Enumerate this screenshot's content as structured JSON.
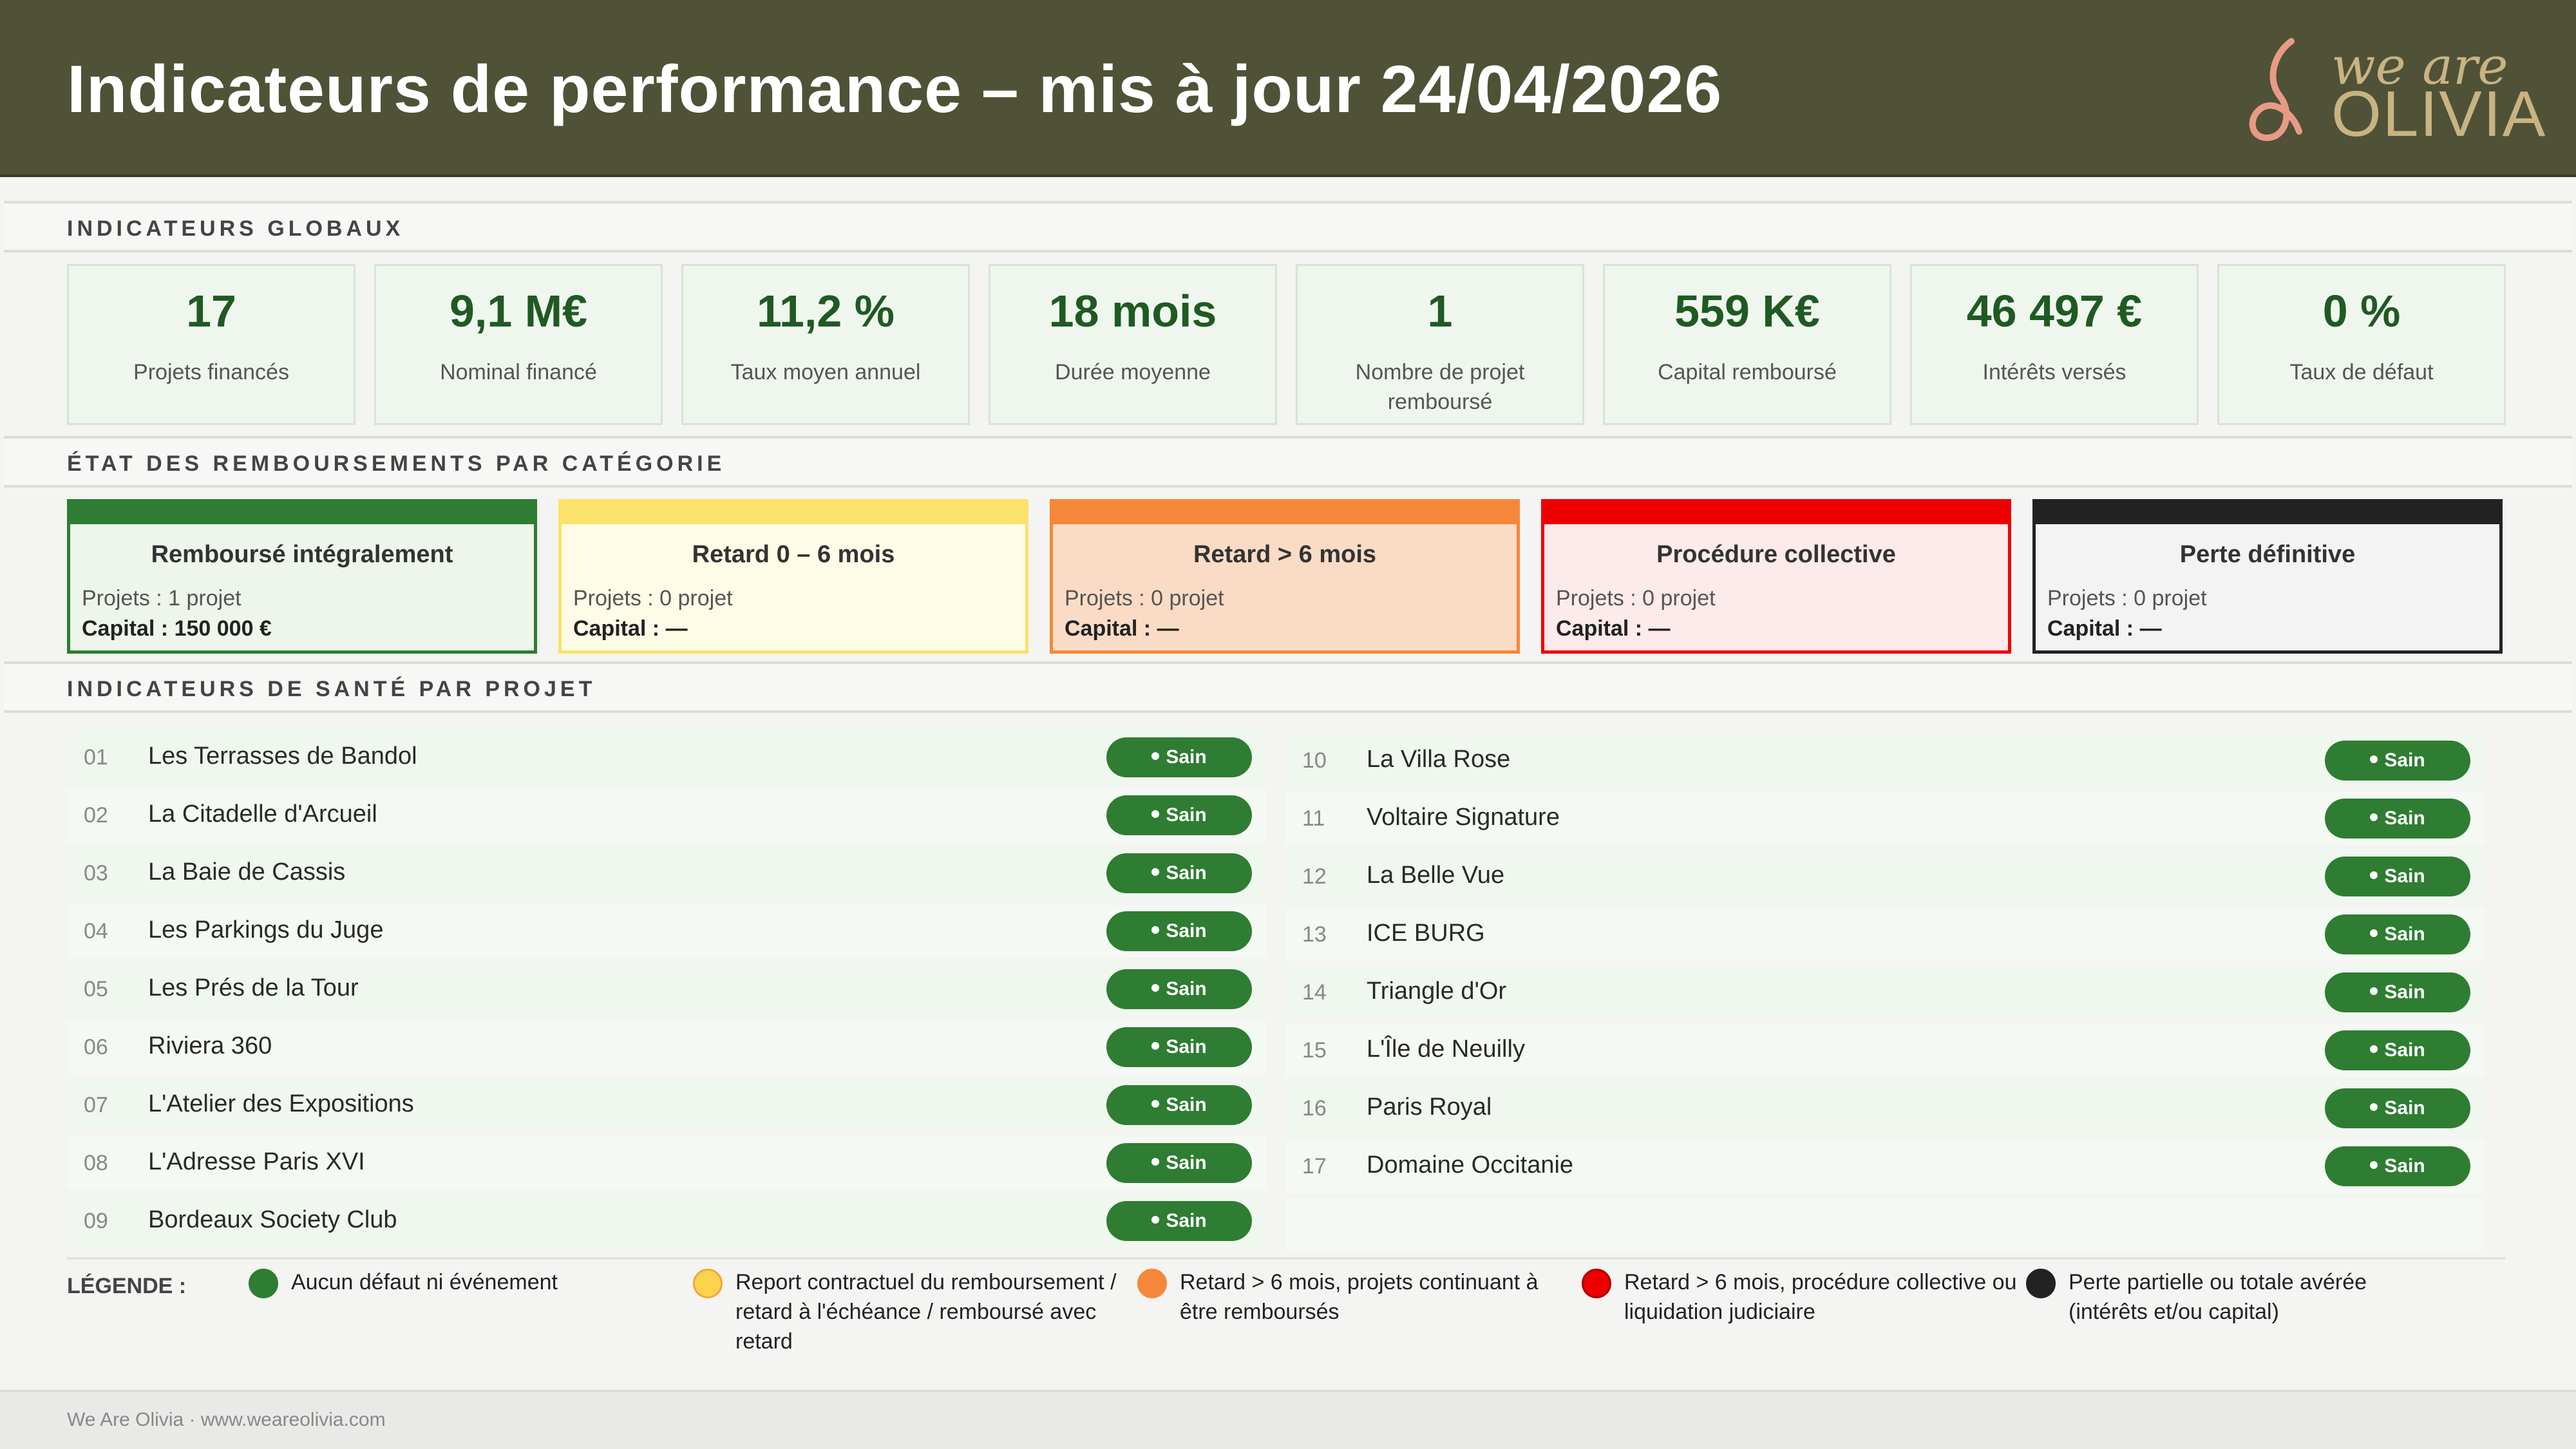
{
  "header": {
    "title": "Indicateurs de performance – mis à jour 24/04/2026",
    "logo_line1": "we are",
    "logo_line2": "OLIVIA"
  },
  "sections": {
    "global": "INDICATEURS GLOBAUX",
    "categories": "ÉTAT DES REMBOURSEMENTS PAR CATÉGORIE",
    "health": "INDICATEURS DE SANTÉ PAR PROJET"
  },
  "kpis": [
    {
      "value": "17",
      "label": "Projets financés"
    },
    {
      "value": "9,1 M€",
      "label": "Nominal financé"
    },
    {
      "value": "11,2 %",
      "label": "Taux moyen annuel"
    },
    {
      "value": "18 mois",
      "label": "Durée moyenne"
    },
    {
      "value": "1",
      "label": "Nombre de projet remboursé"
    },
    {
      "value": "559 K€",
      "label": "Capital remboursé"
    },
    {
      "value": "46 497 €",
      "label": "Intérêts versés"
    },
    {
      "value": "0 %",
      "label": "Taux de défaut"
    }
  ],
  "categories": [
    {
      "title": "Remboursé  intégralement",
      "projects": "Projets : 1 projet",
      "capital": "Capital : 150 000 €",
      "color": "#2e7d32",
      "bg": "#eef6ec"
    },
    {
      "title": "Retard  0 – 6 mois",
      "projects": "Projets : 0 projet",
      "capital": "Capital : —",
      "color": "#fbe26a",
      "bg": "#fefbe6"
    },
    {
      "title": "Retard  > 6 mois",
      "projects": "Projets : 0 projet",
      "capital": "Capital : —",
      "color": "#f5873a",
      "bg": "#fadcc6"
    },
    {
      "title": "Procédure  collective",
      "projects": "Projets : 0 projet",
      "capital": "Capital : —",
      "color": "#ee0000",
      "bg": "#fdeaeb"
    },
    {
      "title": "Perte  définitive",
      "projects": "Projets : 0 projet",
      "capital": "Capital : —",
      "color": "#222222",
      "bg": "#f3f3f3"
    }
  ],
  "status_label": "Sain",
  "projects_left": [
    {
      "num": "01",
      "name": "Les Terrasses de Bandol"
    },
    {
      "num": "02",
      "name": "La Citadelle d'Arcueil"
    },
    {
      "num": "03",
      "name": "La Baie de Cassis"
    },
    {
      "num": "04",
      "name": "Les Parkings du Juge"
    },
    {
      "num": "05",
      "name": "Les Prés de la Tour"
    },
    {
      "num": "06",
      "name": "Riviera 360"
    },
    {
      "num": "07",
      "name": "L'Atelier des Expositions"
    },
    {
      "num": "08",
      "name": "L'Adresse Paris XVI"
    },
    {
      "num": "09",
      "name": "Bordeaux Society Club"
    }
  ],
  "projects_right": [
    {
      "num": "10",
      "name": "La Villa Rose"
    },
    {
      "num": "11",
      "name": "Voltaire Signature"
    },
    {
      "num": "12",
      "name": "La Belle Vue"
    },
    {
      "num": "13",
      "name": "ICE BURG"
    },
    {
      "num": "14",
      "name": "Triangle d'Or"
    },
    {
      "num": "15",
      "name": "L'Île de Neuilly"
    },
    {
      "num": "16",
      "name": "Paris Royal"
    },
    {
      "num": "17",
      "name": "Domaine Occitanie"
    }
  ],
  "legend": {
    "title": "LÉGENDE :",
    "items": [
      {
        "color": "#2e7d32",
        "text": "Aucun défaut ni événement"
      },
      {
        "color": "#fbd34d",
        "text": "Report contractuel du remboursement / retard à l'échéance / remboursé avec retard"
      },
      {
        "color": "#f5873a",
        "text": "Retard > 6 mois, projets continuant à être remboursés"
      },
      {
        "color": "#ee0000",
        "text": "Retard > 6 mois, procédure collective ou liquidation judiciaire"
      },
      {
        "color": "#222222",
        "text": "Perte partielle ou totale avérée (intérêts et/ou capital)"
      }
    ]
  },
  "footer": "We Are Olivia  ·  www.weareolivia.com"
}
